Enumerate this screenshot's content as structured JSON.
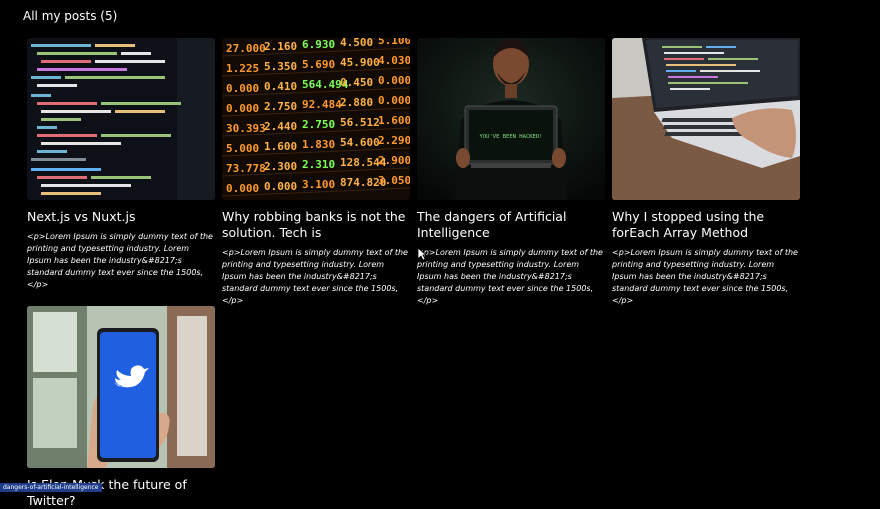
{
  "page": {
    "heading": "All my posts (5)"
  },
  "posts": [
    {
      "title": "Next.js vs Nuxt.js",
      "excerpt": "<p>Lorem Ipsum is simply dummy text of the printing and typesetting industry. Lorem Ipsum has been the industry&#8217;s standard dummy text ever since the 1500s,</p>",
      "image": "code-editor-dark"
    },
    {
      "title": "Why robbing banks is not the solution. Tech is",
      "excerpt": "<p>Lorem Ipsum is simply dummy text of the printing and typesetting industry. Lorem Ipsum has been the industry&#8217;s standard dummy text ever since the 1500s,</p>",
      "image": "stock-ticker-board"
    },
    {
      "title": "The dangers of Artificial Intelligence",
      "excerpt": "<p>Lorem Ipsum is simply dummy text of the printing and typesetting industry. Lorem Ipsum has been the industry&#8217;s standard dummy text ever since the 1500s,</p>",
      "image": "man-holding-hacked-laptop",
      "image_text": "YOU'VE BEEN HACKED!"
    },
    {
      "title": "Why I stopped using the forEach Array Method",
      "excerpt": "<p>Lorem Ipsum is simply dummy text of the printing and typesetting industry. Lorem Ipsum has been the industry&#8217;s standard dummy text ever since the 1500s,</p>",
      "image": "laptop-typing"
    },
    {
      "title": "Is Elon Musk the future of Twitter?",
      "image": "phone-twitter-logo"
    }
  ],
  "status_bar": {
    "url": "dangers-of-artificial-intelligence"
  },
  "ticker_numbers": [
    "27.000",
    "2.160",
    "6.930",
    "4.500",
    "5.100",
    "1.225",
    "5.350",
    "5.690",
    "45.900",
    "4.030",
    "0.000",
    "0.410",
    "564.494",
    "0.450",
    "0.000",
    "0.000",
    "2.750",
    "92.484",
    "2.880",
    "0.000",
    "30.393",
    "2.440",
    "2.750",
    "56.512",
    "1.600",
    "5.000",
    "1.600",
    "1.830",
    "54.600",
    "2.290",
    "73.778",
    "2.300",
    "2.310",
    "128.544",
    "2.900",
    "0.000",
    "0.000",
    "3.100",
    "874.820",
    "3.050"
  ]
}
